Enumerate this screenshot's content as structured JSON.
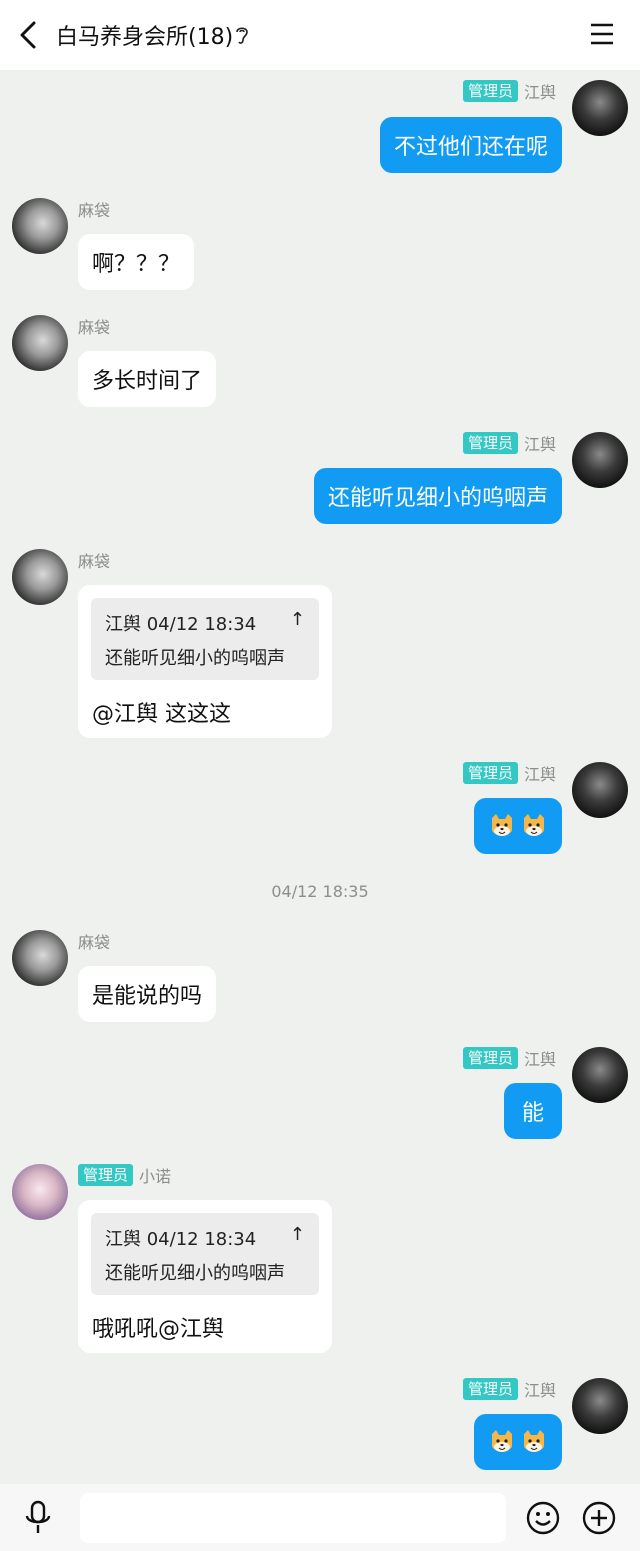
{
  "header": {
    "title": "白马养身会所(18)"
  },
  "messages": [
    {
      "sender": "江舆",
      "badge": "管理员",
      "text": "不过他们还在呢"
    },
    {
      "sender": "麻袋",
      "text": "啊？？？"
    },
    {
      "sender": "麻袋",
      "text": "多长时间了"
    },
    {
      "sender": "江舆",
      "badge": "管理员",
      "text": "还能听见细小的呜咽声"
    },
    {
      "sender": "麻袋",
      "quote": {
        "header": "江舆 04/12 18:34",
        "text": "还能听见细小的呜咽声"
      },
      "text": "@江舆 这这这"
    },
    {
      "sender": "江舆",
      "badge": "管理员",
      "emoji": "dog-face-emoji"
    },
    {
      "sender": "麻袋",
      "text": "是能说的吗"
    },
    {
      "sender": "江舆",
      "badge": "管理员",
      "text": "能"
    },
    {
      "sender": "小诺",
      "badge": "管理员",
      "quote": {
        "header": "江舆 04/12 18:34",
        "text": "还能听见细小的呜咽声"
      },
      "text": "哦吼吼@江舆"
    },
    {
      "sender": "江舆",
      "badge": "管理员",
      "emoji": "dog-face-emoji"
    }
  ],
  "timestamp": "04/12 18:35",
  "quote_pin_icon": "↑",
  "colors": {
    "accent": "#129bf3",
    "badge": "#33c8c4",
    "background": "#eef1ee"
  }
}
